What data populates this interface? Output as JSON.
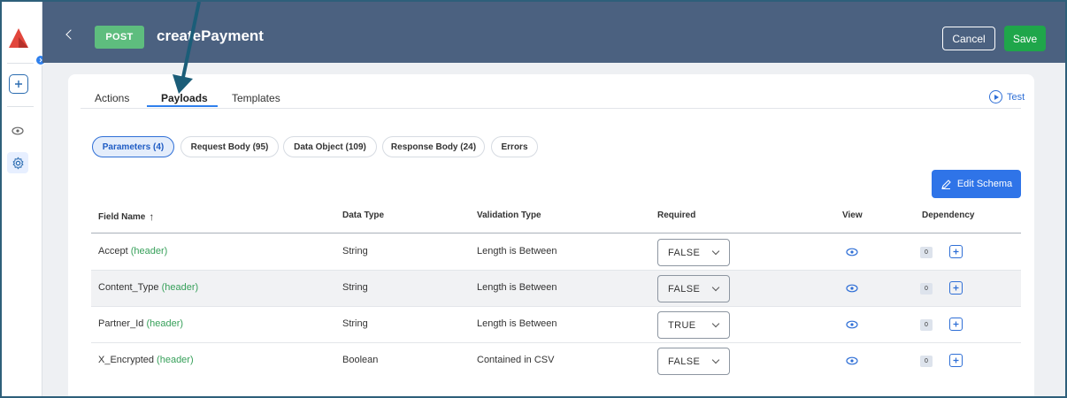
{
  "header": {
    "method": "POST",
    "title": "createPayment",
    "cancel_label": "Cancel",
    "save_label": "Save"
  },
  "tabs": [
    {
      "label": "Actions",
      "active": false
    },
    {
      "label": "Payloads",
      "active": true
    },
    {
      "label": "Templates",
      "active": false
    }
  ],
  "test_label": "Test",
  "filters": [
    {
      "label": "Parameters (4)",
      "active": true
    },
    {
      "label": "Request Body (95)",
      "active": false
    },
    {
      "label": "Data Object (109)",
      "active": false
    },
    {
      "label": "Response Body (24)",
      "active": false
    },
    {
      "label": "Errors",
      "active": false
    }
  ],
  "edit_schema_label": "Edit Schema",
  "table": {
    "columns": [
      "Field Name",
      "Data Type",
      "Validation Type",
      "Required",
      "View",
      "Dependency"
    ],
    "sort_indicator": "↑",
    "rows": [
      {
        "field": "Accept",
        "location": "(header)",
        "type": "String",
        "validation": "Length is Between",
        "required": "FALSE",
        "deps": "0"
      },
      {
        "field": "Content_Type",
        "location": "(header)",
        "type": "String",
        "validation": "Length is Between",
        "required": "FALSE",
        "deps": "0"
      },
      {
        "field": "Partner_Id",
        "location": "(header)",
        "type": "String",
        "validation": "Length is Between",
        "required": "TRUE",
        "deps": "0"
      },
      {
        "field": "X_Encrypted",
        "location": "(header)",
        "type": "Boolean",
        "validation": "Contained in CSV",
        "required": "FALSE",
        "deps": "0"
      }
    ]
  },
  "colors": {
    "header_bg": "#4b6180",
    "method_badge": "#5ebd7e",
    "save_green": "#1fa64a",
    "accent_blue": "#2f74e8",
    "location_green": "#37a05a",
    "annotation_arrow": "#1b5d78"
  },
  "icons": [
    "app-logo-icon",
    "add-box-icon",
    "eye-icon",
    "gear-icon",
    "back-chevron-icon",
    "play-circle-icon",
    "pencil-icon",
    "sort-arrow-up-icon",
    "chevron-down-icon",
    "plus-box-icon"
  ]
}
